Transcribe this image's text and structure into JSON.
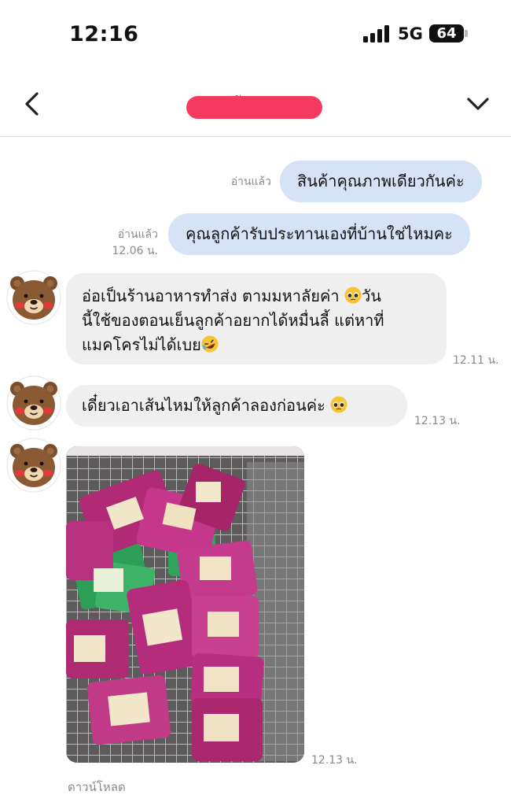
{
  "status_bar": {
    "time": "12:16",
    "network": "5G",
    "battery": "64"
  },
  "header": {
    "title": "ตัวแทน",
    "title_redacted": true,
    "redact_color": "#f43a5e",
    "back_icon": "chevron-left-icon",
    "menu_icon": "chevron-down-icon"
  },
  "messages": [
    {
      "direction": "out",
      "text": "สินค้าคุณภาพเดียวกันค่ะ",
      "read_label": "อ่านแล้ว",
      "time": ""
    },
    {
      "direction": "out",
      "text": "คุณลูกค้ารับประทานเองที่บ้านใช่ไหมคะ",
      "read_label": "อ่านแล้ว",
      "time": "12.06 น."
    },
    {
      "direction": "in",
      "lines": [
        "อ่อเป็นร้านอาหารทำส่ง ตามมหาลัยค่า",
        "วัน",
        "นี้ใช้ของตอนเย็นลูกค้าอยากได้หมื่นลี้ แต่หาที่",
        "แมคโครไม่ได้เบย"
      ],
      "emojis": [
        "pleading-face-emoji",
        "rofl-emoji"
      ],
      "time": "12.11 น."
    },
    {
      "direction": "in",
      "text": "เดี๋ยวเอาเส้นไหมให้ลูกค้าลองก่อนค่ะ",
      "emojis": [
        "pleading-face-emoji"
      ],
      "time": "12.13 น."
    },
    {
      "direction": "in",
      "type": "image",
      "image_desc": "noodle-packets-in-shopping-cart",
      "time": "12.13 น.",
      "download_label": "ดาวน์โหลด"
    }
  ],
  "colors": {
    "bubble_out": "#d6e3f7",
    "bubble_in": "#efefef",
    "meta_text": "#8a8a8a"
  },
  "avatar_icon": "brown-bear-avatar-icon"
}
